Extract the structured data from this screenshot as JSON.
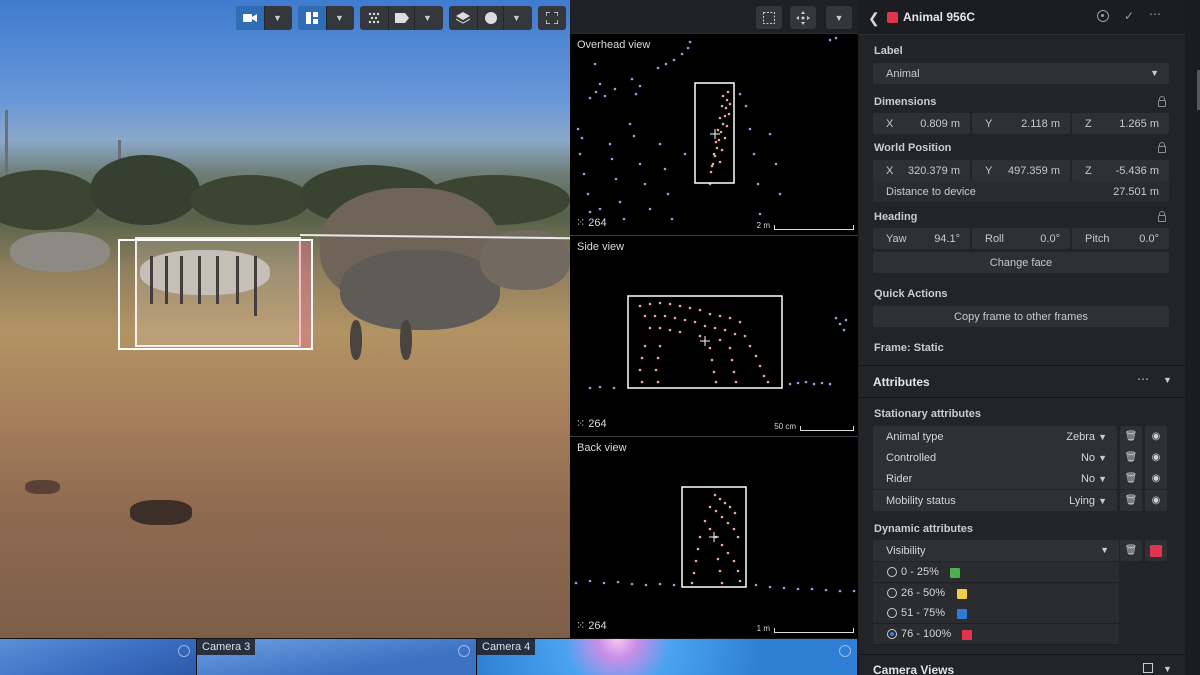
{
  "camera": {
    "toolbar": {
      "video_icon": "video-camera-icon",
      "layout_icon": "grid-layout-icon",
      "points_icon": "point-cloud-icon",
      "label_icon": "tag-icon",
      "layers_icon": "layers-icon",
      "circle_icon": "circle-icon",
      "fullscreen_icon": "fullscreen-icon"
    }
  },
  "views": [
    {
      "title": "Overhead view",
      "count": "264",
      "scale": "2 m"
    },
    {
      "title": "Side view",
      "count": "264",
      "scale": "50 cm"
    },
    {
      "title": "Back view",
      "count": "264",
      "scale": "1 m"
    }
  ],
  "camera_strip": [
    {
      "label": ""
    },
    {
      "label": "Camera 3"
    },
    {
      "label": "Camera 4"
    }
  ],
  "panel": {
    "title": "Animal 956C",
    "title_color": "#e0344f",
    "label_section": "Label",
    "label_value": "Animal",
    "dimensions": {
      "title": "Dimensions",
      "x_label": "X",
      "x_value": "0.809 m",
      "y_label": "Y",
      "y_value": "2.118 m",
      "z_label": "Z",
      "z_value": "1.265 m"
    },
    "world_position": {
      "title": "World Position",
      "x_label": "X",
      "x_value": "320.379 m",
      "y_label": "Y",
      "y_value": "497.359 m",
      "z_label": "Z",
      "z_value": "-5.436 m",
      "distance_label": "Distance to device",
      "distance_value": "27.501 m"
    },
    "heading": {
      "title": "Heading",
      "yaw_label": "Yaw",
      "yaw_value": "94.1°",
      "roll_label": "Roll",
      "roll_value": "0.0°",
      "pitch_label": "Pitch",
      "pitch_value": "0.0°",
      "change_face": "Change face"
    },
    "quick_actions": {
      "title": "Quick Actions",
      "copy_frame": "Copy frame to other frames"
    },
    "frame": "Frame: Static",
    "attributes": {
      "title": "Attributes",
      "stationary_title": "Stationary attributes",
      "stationary": [
        {
          "label": "Animal type",
          "value": "Zebra"
        },
        {
          "label": "Controlled",
          "value": "No"
        },
        {
          "label": "Rider",
          "value": "No"
        },
        {
          "label": "Mobility status",
          "value": "Lying"
        }
      ],
      "dynamic_title": "Dynamic attributes",
      "visibility_label": "Visibility",
      "visibility_color": "#e0344f",
      "visibility_options": [
        {
          "label": "0 - 25%",
          "color": "#4caf50",
          "selected": false
        },
        {
          "label": "26 - 50%",
          "color": "#f2cf4a",
          "selected": false
        },
        {
          "label": "51 - 75%",
          "color": "#2f7bd6",
          "selected": false
        },
        {
          "label": "76 - 100%",
          "color": "#e0344f",
          "selected": true
        }
      ]
    },
    "camera_views": "Camera Views"
  }
}
